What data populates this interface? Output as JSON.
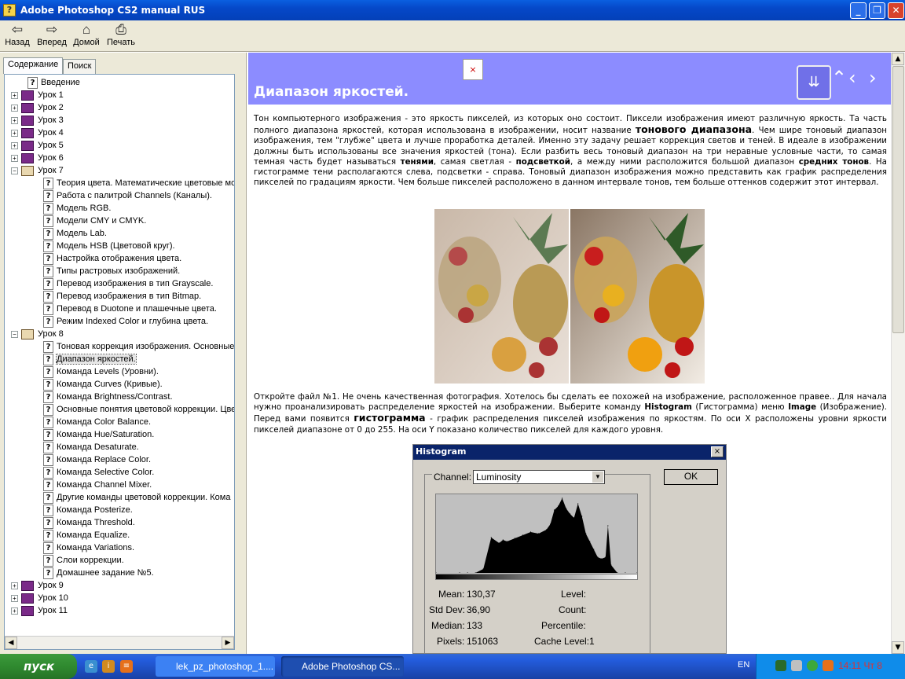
{
  "window": {
    "title": "Adobe Photoshop CS2 manual RUS",
    "app_icon": "?"
  },
  "toolbar": {
    "back": "Назад",
    "forward": "Вперед",
    "home": "Домой",
    "print": "Печать"
  },
  "tabs": {
    "contents": "Содержание",
    "search": "Поиск"
  },
  "tree": {
    "items": [
      {
        "label": "Введение",
        "kind": "page",
        "level": 0
      },
      {
        "label": "Урок 1",
        "kind": "book",
        "level": 0,
        "expanded": false
      },
      {
        "label": "Урок 2",
        "kind": "book",
        "level": 0,
        "expanded": false
      },
      {
        "label": "Урок 3",
        "kind": "book",
        "level": 0,
        "expanded": false
      },
      {
        "label": "Урок 4",
        "kind": "book",
        "level": 0,
        "expanded": false
      },
      {
        "label": "Урок 5",
        "kind": "book",
        "level": 0,
        "expanded": false
      },
      {
        "label": "Урок 6",
        "kind": "book",
        "level": 0,
        "expanded": false
      },
      {
        "label": "Урок 7",
        "kind": "book",
        "level": 0,
        "expanded": true
      },
      {
        "label": "Теория цвета. Математические цветовые мо",
        "kind": "page",
        "level": 1
      },
      {
        "label": "Работа с палитрой Channels (Каналы).",
        "kind": "page",
        "level": 1
      },
      {
        "label": "Модель RGB.",
        "kind": "page",
        "level": 1
      },
      {
        "label": "Модели CMY и CMYK.",
        "kind": "page",
        "level": 1
      },
      {
        "label": "Модель Lab.",
        "kind": "page",
        "level": 1
      },
      {
        "label": "Модель HSB (Цветовой круг).",
        "kind": "page",
        "level": 1
      },
      {
        "label": "Настройка отображения цвета.",
        "kind": "page",
        "level": 1
      },
      {
        "label": "Типы растровых изображений.",
        "kind": "page",
        "level": 1
      },
      {
        "label": "Перевод изображения в тип Grayscale.",
        "kind": "page",
        "level": 1
      },
      {
        "label": "Перевод изображения в тип Bitmap.",
        "kind": "page",
        "level": 1
      },
      {
        "label": "Перевод в Duotone и плашечные цвета.",
        "kind": "page",
        "level": 1
      },
      {
        "label": "Режим Indexed Color и глубина цвета.",
        "kind": "page",
        "level": 1
      },
      {
        "label": "Урок 8",
        "kind": "book",
        "level": 0,
        "expanded": true
      },
      {
        "label": "Тоновая коррекция изображения. Основные",
        "kind": "page",
        "level": 1
      },
      {
        "label": "Диапазон яркостей.",
        "kind": "page",
        "level": 1,
        "selected": true
      },
      {
        "label": "Команда Levels (Уровни).",
        "kind": "page",
        "level": 1
      },
      {
        "label": "Команда Curves (Кривые).",
        "kind": "page",
        "level": 1
      },
      {
        "label": "Команда Brightness/Contrast.",
        "kind": "page",
        "level": 1
      },
      {
        "label": "Основные понятия цветовой коррекции. Цве",
        "kind": "page",
        "level": 1
      },
      {
        "label": "Команда Color Balance.",
        "kind": "page",
        "level": 1
      },
      {
        "label": "Команда Hue/Saturation.",
        "kind": "page",
        "level": 1
      },
      {
        "label": "Команда Desaturate.",
        "kind": "page",
        "level": 1
      },
      {
        "label": "Команда Replace Color.",
        "kind": "page",
        "level": 1
      },
      {
        "label": "Команда Selective Color.",
        "kind": "page",
        "level": 1
      },
      {
        "label": "Команда Channel Mixer.",
        "kind": "page",
        "level": 1
      },
      {
        "label": "Другие команды цветовой коррекции. Кома",
        "kind": "page",
        "level": 1
      },
      {
        "label": "Команда Posterize.",
        "kind": "page",
        "level": 1
      },
      {
        "label": "Команда Threshold.",
        "kind": "page",
        "level": 1
      },
      {
        "label": "Команда Equalize.",
        "kind": "page",
        "level": 1
      },
      {
        "label": "Команда Variations.",
        "kind": "page",
        "level": 1
      },
      {
        "label": "Слои коррекции.",
        "kind": "page",
        "level": 1
      },
      {
        "label": "Домашнее задание №5.",
        "kind": "page",
        "level": 1
      },
      {
        "label": "Урок 9",
        "kind": "book",
        "level": 0,
        "expanded": false
      },
      {
        "label": "Урок 10",
        "kind": "book",
        "level": 0,
        "expanded": false
      },
      {
        "label": "Урок 11",
        "kind": "book",
        "level": 0,
        "expanded": false
      }
    ]
  },
  "content": {
    "title": "Диапазон яркостей.",
    "broken_image": "×",
    "para1": [
      {
        "t": "Тон компьютерного изображения - это яркость пикселей, из которых оно состоит. Пиксели изображения имеют различную яркость. Та часть полного диапазона яркостей, которая использована в изображении, носит название "
      },
      {
        "t": "тонового диапазона",
        "b": true,
        "big": true
      },
      {
        "t": ". Чем шире тоновый диапазон изображения, тем \"глубже\" цвета и лучше проработка деталей. Именно эту задачу решает коррекция светов и теней. В идеале в изображении должны быть использованы все значения яркостей (тона). Если разбить весь тоновый диапазон на три неравные условные части, то самая темная часть будет называться "
      },
      {
        "t": "тенями",
        "b": true
      },
      {
        "t": ", самая светлая - "
      },
      {
        "t": "подсветкой",
        "b": true
      },
      {
        "t": ", а между ними расположится большой диапазон "
      },
      {
        "t": "средних тонов",
        "b": true
      },
      {
        "t": ". На гистограмме тени располагаются слева, подсветки - справа. Тоновый диапазон изображения можно представить как график распределения пикселей по градациям яркости. Чем больше пикселей расположено в данном интервале тонов, тем больше оттенков содержит этот интервал."
      }
    ],
    "para2": [
      {
        "t": "Откройте файл №1. Не очень качественная фотография. Хотелось бы сделать ее похожей на изображение, расположенное правее.. Для начала нужно проанализировать распределение яркостей на изображении. Выберите команду "
      },
      {
        "t": "Histogram",
        "b": true
      },
      {
        "t": " (Гистограмма) меню "
      },
      {
        "t": "Image",
        "b": true
      },
      {
        "t": " (Изображение). Перед вами появится "
      },
      {
        "t": "гистограмма",
        "b": true,
        "big": true
      },
      {
        "t": " - график распределения пикселей изображения по яркостям. По оси X расположены уровни яркости пикселей диапазоне от 0 до 255. На оси Y показано количество пикселей для каждого уровня."
      }
    ]
  },
  "histogram": {
    "title": "Histogram",
    "close": "×",
    "channel_label": "Channel:",
    "channel_value": "Luminosity",
    "ok": "OK",
    "mean_label": "Mean:",
    "mean": "130,37",
    "stddev_label": "Std Dev:",
    "stddev": "36,90",
    "median_label": "Median:",
    "median": "133",
    "pixels_label": "Pixels:",
    "pixels": "151063",
    "level_label": "Level:",
    "count_label": "Count:",
    "percentile_label": "Percentile:",
    "cache_label": "Cache Level:",
    "cache": "1"
  },
  "chart_data": {
    "type": "area",
    "title": "",
    "xlabel": "",
    "ylabel": "",
    "xlim": [
      0,
      255
    ],
    "ylim": [
      0,
      100
    ],
    "x": [
      0,
      30,
      40,
      50,
      60,
      70,
      80,
      85,
      90,
      100,
      110,
      120,
      130,
      140,
      145,
      150,
      155,
      160,
      165,
      170,
      175,
      180,
      185,
      190,
      195,
      200,
      205,
      210,
      215,
      218,
      222,
      230,
      240,
      255
    ],
    "values": [
      0,
      0,
      0,
      0,
      5,
      45,
      38,
      42,
      40,
      44,
      48,
      52,
      50,
      55,
      62,
      80,
      85,
      95,
      82,
      75,
      70,
      88,
      72,
      50,
      40,
      30,
      20,
      18,
      20,
      60,
      10,
      0,
      0,
      0
    ]
  },
  "taskbar": {
    "start": "пуск",
    "task1": "lek_pz_photoshop_1....",
    "task2": "Adobe Photoshop CS...",
    "lang": "EN",
    "clock": "14:11 Чт 8"
  },
  "colors": {
    "header": "#8c8cff",
    "titlebar": "#0548c8",
    "taskbar": "#245ee0",
    "start": "#2f8a2f"
  }
}
